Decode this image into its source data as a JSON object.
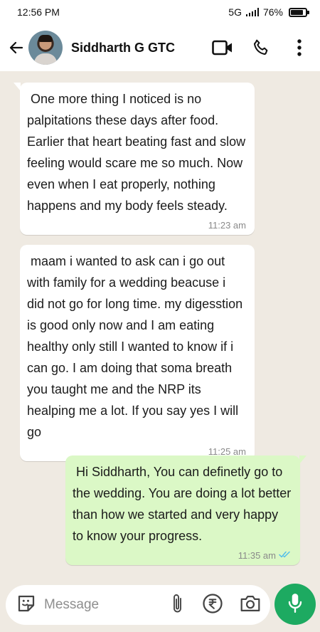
{
  "status_bar": {
    "time": "12:56 PM",
    "network": "5G",
    "battery": "76%",
    "battery_level": 0.76
  },
  "header": {
    "contact_name": "Siddharth G GTC",
    "icons": [
      "back-arrow-icon",
      "video-call-icon",
      "phone-icon",
      "more-options-icon"
    ]
  },
  "messages": [
    {
      "direction": "incoming",
      "text": " One more thing I noticed is no palpitations these days after food. Earlier that heart beating fast and slow feeling would scare me so much. Now even when I eat properly, nothing happens and my body feels steady.",
      "time": "11:23 am"
    },
    {
      "direction": "incoming",
      "text": " maam i wanted to ask can i go out with family for a wedding beacuse i did not go for long time. my digesstion is good only now and I am eating healthy only still I wanted to know if i can go. I am doing that soma breath you taught me and the NRP its healping me a lot. If you say yes I will go",
      "time": "11:25 am"
    },
    {
      "direction": "outgoing",
      "text": " Hi Siddharth, You can definetly go to the wedding. You are doing a lot better than how we started and very happy to know your progress.",
      "time": "11:35 am",
      "status": "read"
    }
  ],
  "input": {
    "placeholder": "Message",
    "icons": [
      "sticker-icon",
      "attach-icon",
      "rupee-payment-icon",
      "camera-icon",
      "mic-icon"
    ]
  },
  "colors": {
    "incoming_bubble": "#ffffff",
    "outgoing_bubble": "#dbf8c6",
    "chat_background": "#efeae2",
    "accent_green": "#1daa61",
    "read_ticks": "#53bdeb"
  }
}
